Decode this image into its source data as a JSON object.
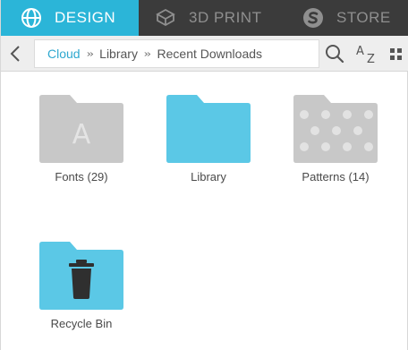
{
  "tabs": [
    {
      "label": "DESIGN",
      "icon": "globe-icon",
      "active": true
    },
    {
      "label": "3D PRINT",
      "icon": "cube-icon",
      "active": false
    },
    {
      "label": "STORE",
      "icon": "store-s-icon",
      "active": false
    }
  ],
  "toolbar": {
    "back_icon": "chevron-left-icon",
    "breadcrumb": [
      "Cloud",
      "Library",
      "Recent Downloads"
    ],
    "search_icon": "search-icon",
    "sort_icon": "sort-az-icon",
    "view_icon": "grid-view-icon"
  },
  "items": [
    {
      "label": "Fonts (29)",
      "icon": "font-folder-icon"
    },
    {
      "label": "Library",
      "icon": "folder-icon"
    },
    {
      "label": "Patterns (14)",
      "icon": "pattern-folder-icon"
    },
    {
      "label": "Recycle Bin",
      "icon": "trash-folder-icon"
    }
  ],
  "colors": {
    "accent": "#2bb5d8",
    "folder_blue": "#5bc8e6",
    "folder_gray": "#c8c8c8",
    "tabbar": "#3b3b3b"
  }
}
